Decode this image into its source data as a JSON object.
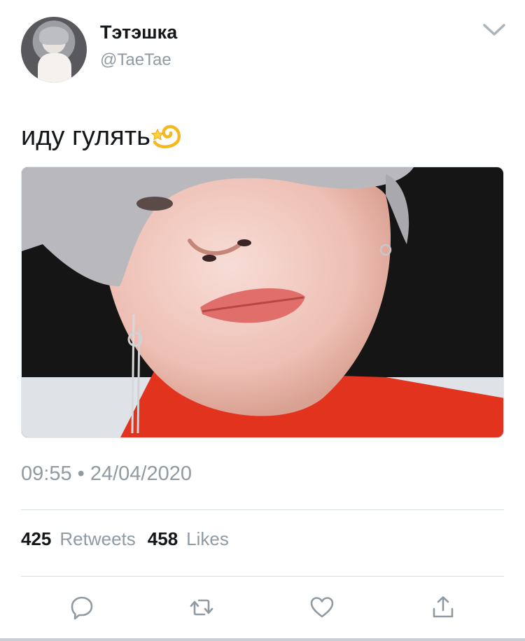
{
  "author": {
    "display_name": "Тэтэшка",
    "handle": "@TaeTae"
  },
  "tweet": {
    "text": "иду гулять",
    "emoji": "dizzy-emoji",
    "timestamp": "09:55 • 24/04/2020"
  },
  "stats": {
    "retweets_count": "425",
    "retweets_label": "Retweets",
    "likes_count": "458",
    "likes_label": "Likes"
  },
  "actions": {
    "icons": [
      "reply-icon",
      "retweet-icon",
      "like-icon",
      "share-icon"
    ]
  },
  "colors": {
    "text_primary": "#14171a",
    "text_secondary": "#8f9aa3",
    "divider": "#d7dee3",
    "icon": "#8f9aa3"
  }
}
